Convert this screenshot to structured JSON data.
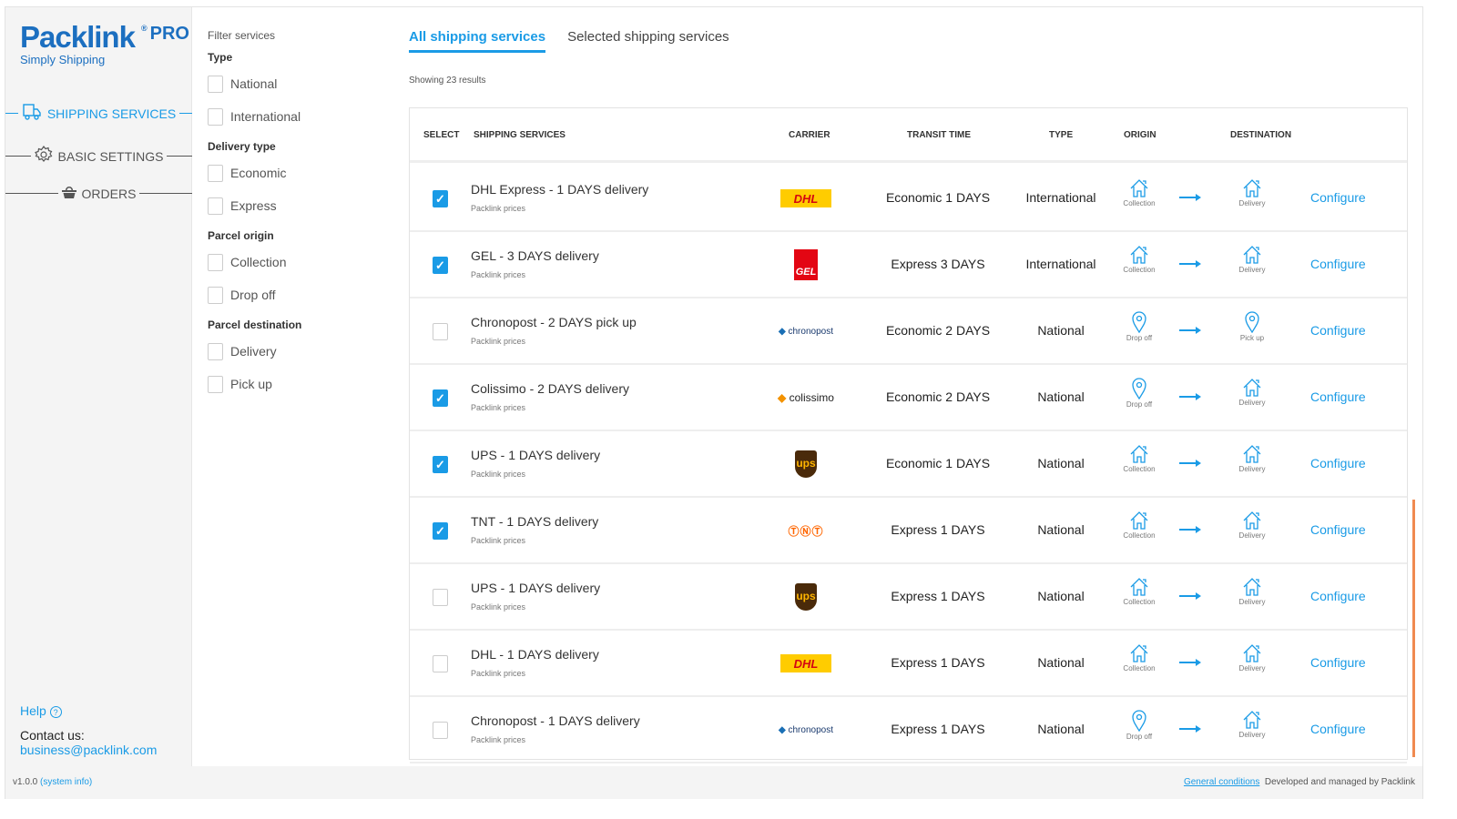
{
  "brand": {
    "name": "Packlink",
    "pro": "PRO",
    "tagline": "Simply Shipping",
    "color": "#1c6fc0"
  },
  "nav": [
    {
      "label": "SHIPPING SERVICES",
      "icon": "truck-icon",
      "active": true
    },
    {
      "label": "BASIC SETTINGS",
      "icon": "gear-icon"
    },
    {
      "label": "ORDERS",
      "icon": "basket-icon"
    }
  ],
  "help": "Help",
  "contact_label": "Contact us:",
  "contact_email": "business@packlink.com",
  "filters": {
    "title": "Filter services",
    "groups": [
      {
        "label": "Type",
        "items": [
          "National",
          "International"
        ]
      },
      {
        "label": "Delivery type",
        "items": [
          "Economic",
          "Express"
        ]
      },
      {
        "label": "Parcel origin",
        "items": [
          "Collection",
          "Drop off"
        ]
      },
      {
        "label": "Parcel destination",
        "items": [
          "Delivery",
          "Pick up"
        ]
      }
    ]
  },
  "tabs": [
    "All shipping services",
    "Selected shipping services"
  ],
  "results": "Showing 23 results",
  "columns": [
    "SELECT",
    "SHIPPING SERVICES",
    "CARRIER",
    "TRANSIT TIME",
    "TYPE",
    "ORIGIN",
    "DESTINATION"
  ],
  "price_note": "Packlink prices",
  "configure": "Configure",
  "rows": [
    {
      "selected": true,
      "name": "DHL Express - 1 DAYS delivery",
      "carrier": "DHL",
      "transit": "Economic 1 DAYS",
      "type": "International",
      "origin": "Collection",
      "destination": "Delivery"
    },
    {
      "selected": true,
      "name": "GEL - 3 DAYS delivery",
      "carrier": "GEL",
      "transit": "Express 3 DAYS",
      "type": "International",
      "origin": "Collection",
      "destination": "Delivery"
    },
    {
      "selected": false,
      "name": "Chronopost - 2 DAYS pick up",
      "carrier": "chronopost",
      "transit": "Economic 2 DAYS",
      "type": "National",
      "origin": "Drop off",
      "destination": "Pick up"
    },
    {
      "selected": true,
      "name": "Colissimo - 2 DAYS delivery",
      "carrier": "colissimo",
      "transit": "Economic 2 DAYS",
      "type": "National",
      "origin": "Drop off",
      "destination": "Delivery"
    },
    {
      "selected": true,
      "name": "UPS - 1 DAYS delivery",
      "carrier": "ups",
      "transit": "Economic 1 DAYS",
      "type": "National",
      "origin": "Collection",
      "destination": "Delivery"
    },
    {
      "selected": true,
      "name": "TNT - 1 DAYS delivery",
      "carrier": "TNT",
      "transit": "Express 1 DAYS",
      "type": "National",
      "origin": "Collection",
      "destination": "Delivery"
    },
    {
      "selected": false,
      "name": "UPS - 1 DAYS delivery",
      "carrier": "ups",
      "transit": "Express 1 DAYS",
      "type": "National",
      "origin": "Collection",
      "destination": "Delivery"
    },
    {
      "selected": false,
      "name": "DHL - 1 DAYS delivery",
      "carrier": "DHL",
      "transit": "Express 1 DAYS",
      "type": "National",
      "origin": "Collection",
      "destination": "Delivery"
    },
    {
      "selected": false,
      "name": "Chronopost - 1 DAYS delivery",
      "carrier": "chronopost",
      "transit": "Express 1 DAYS",
      "type": "National",
      "origin": "Drop off",
      "destination": "Delivery"
    }
  ],
  "footer": {
    "version": "v1.0.0",
    "system_info": "(system info)",
    "conditions": "General conditions",
    "managed": "Developed and managed by Packlink"
  },
  "accent": "#1a9be6"
}
